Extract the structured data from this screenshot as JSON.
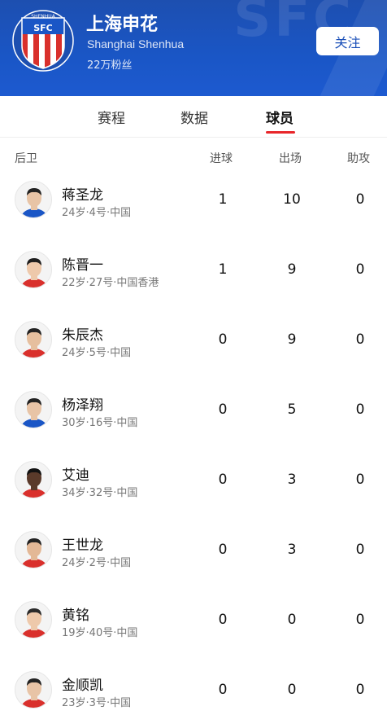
{
  "team": {
    "name": "上海申花",
    "name_en": "Shanghai Shenhua",
    "fans": "22万粉丝",
    "watermark": "SFC",
    "follow_label": "关注",
    "logo_text_top": "SHENHUA",
    "logo_text_mid": "SFC"
  },
  "tabs": [
    {
      "label": "赛程",
      "active": false
    },
    {
      "label": "数据",
      "active": false
    },
    {
      "label": "球员",
      "active": true
    }
  ],
  "table": {
    "section_label": "后卫",
    "columns": [
      "进球",
      "出场",
      "助攻"
    ],
    "players": [
      {
        "name": "蒋圣龙",
        "meta": "24岁·4号·中国",
        "goals": "1",
        "apps": "10",
        "assists": "0",
        "shirt": "#1a56c6",
        "skin": "#e8c4a6",
        "hair": "#222"
      },
      {
        "name": "陈晋一",
        "meta": "22岁·27号·中国香港",
        "goals": "1",
        "apps": "9",
        "assists": "0",
        "shirt": "#d9302c",
        "skin": "#eec9ab",
        "hair": "#1d1d1d"
      },
      {
        "name": "朱辰杰",
        "meta": "24岁·5号·中国",
        "goals": "0",
        "apps": "9",
        "assists": "0",
        "shirt": "#d9302c",
        "skin": "#e6bf9e",
        "hair": "#222"
      },
      {
        "name": "杨泽翔",
        "meta": "30岁·16号·中国",
        "goals": "0",
        "apps": "5",
        "assists": "0",
        "shirt": "#1a56c6",
        "skin": "#e8c4a6",
        "hair": "#222"
      },
      {
        "name": "艾迪",
        "meta": "34岁·32号·中国",
        "goals": "0",
        "apps": "3",
        "assists": "0",
        "shirt": "#d9302c",
        "skin": "#5a3a2a",
        "hair": "#111"
      },
      {
        "name": "王世龙",
        "meta": "24岁·2号·中国",
        "goals": "0",
        "apps": "3",
        "assists": "0",
        "shirt": "#d9302c",
        "skin": "#e3b896",
        "hair": "#222"
      },
      {
        "name": "黄铭",
        "meta": "19岁·40号·中国",
        "goals": "0",
        "apps": "0",
        "assists": "0",
        "shirt": "#d9302c",
        "skin": "#eec9ab",
        "hair": "#2a2a2a"
      },
      {
        "name": "金顺凯",
        "meta": "23岁·3号·中国",
        "goals": "0",
        "apps": "0",
        "assists": "0",
        "shirt": "#d9302c",
        "skin": "#e8c4a6",
        "hair": "#222"
      }
    ]
  },
  "colors": {
    "header_blue": "#1a56c6",
    "tab_indicator": "#e8262a"
  }
}
